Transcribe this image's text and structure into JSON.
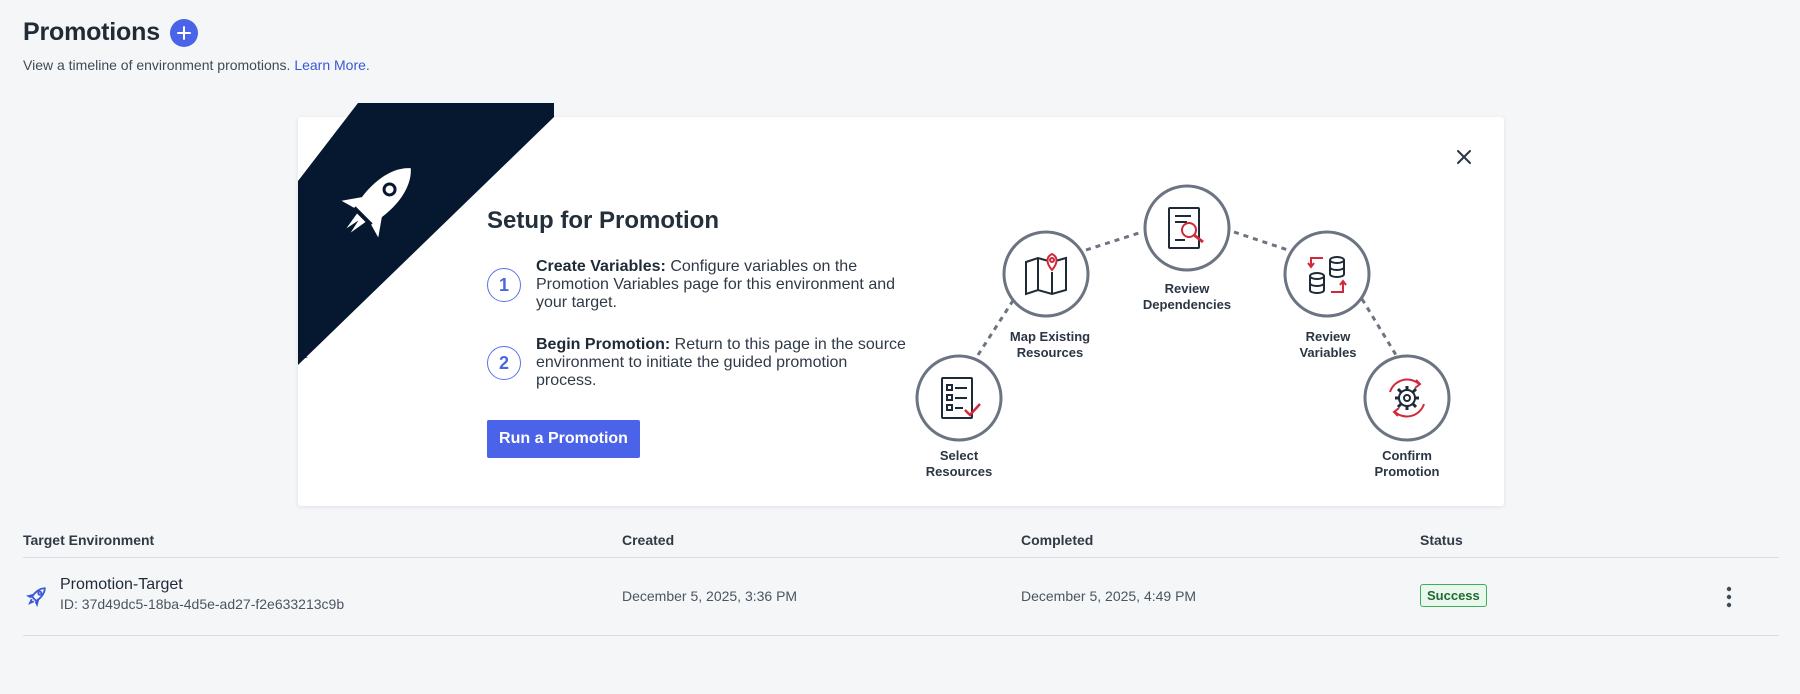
{
  "header": {
    "title": "Promotions",
    "subtitle": "View a timeline of environment promotions.",
    "learn_more": "Learn More."
  },
  "setup": {
    "title": "Setup for Promotion",
    "steps": [
      {
        "number": "1",
        "heading": "Create Variables:",
        "text": "Configure variables on the Promotion Variables page for this environment and your target."
      },
      {
        "number": "2",
        "heading": "Begin Promotion:",
        "text": "Return to this page in the source environment to initiate the guided promotion process."
      }
    ],
    "run_button": "Run a Promotion"
  },
  "diagram": {
    "steps": [
      {
        "line1": "Select",
        "line2": "Resources",
        "icon": "checklist-icon"
      },
      {
        "line1": "Map Existing",
        "line2": "Resources",
        "icon": "map-pin-icon"
      },
      {
        "line1": "Review",
        "line2": "Dependencies",
        "icon": "document-search-icon"
      },
      {
        "line1": "Review",
        "line2": "Variables",
        "icon": "database-transfer-icon"
      },
      {
        "line1": "Confirm",
        "line2": "Promotion",
        "icon": "gear-sync-icon"
      }
    ]
  },
  "table": {
    "columns": [
      "Target Environment",
      "Created",
      "Completed",
      "Status"
    ],
    "rows": [
      {
        "name": "Promotion-Target",
        "id": "ID: 37d49dc5-18ba-4d5e-ad27-f2e633213c9b",
        "created": "December 5, 2025, 3:36 PM",
        "completed": "December 5, 2025, 4:49 PM",
        "status": "Success"
      }
    ]
  },
  "colors": {
    "accent": "#4b63e8",
    "banner": "#061730",
    "success_border": "#3fae5a",
    "icon_red": "#d1283a"
  }
}
